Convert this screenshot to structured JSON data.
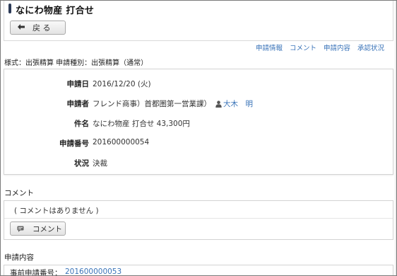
{
  "header": {
    "title": "なにわ物産 打合せ",
    "back_label": "戻 る"
  },
  "nav": {
    "links": [
      "申請情報",
      "コメント",
      "申請内容",
      "承認状況"
    ]
  },
  "form_type": "様式：出張精算 申請種別：出張精算（通常）",
  "info": {
    "date_label": "申請日",
    "date_value": "2016/12/20 (火)",
    "applicant_label": "申請者",
    "applicant_org": "フレンド商事）首都圏第一営業課）",
    "applicant_name": "大木　明",
    "subject_label": "件名",
    "subject_value": "なにわ物産 打合せ 43,300円",
    "number_label": "申請番号",
    "number_value": "201600000054",
    "status_label": "状況",
    "status_value": "決裁"
  },
  "comments": {
    "section_title": "コメント",
    "empty_text": "( コメントはありません )",
    "button_label": "コメント"
  },
  "detail": {
    "section_title": "申請内容",
    "prior_label": "事前申請番号：",
    "prior_value": "201600000053"
  },
  "colors": {
    "link": "#3973b8",
    "title_marker": "#2c3a57"
  }
}
